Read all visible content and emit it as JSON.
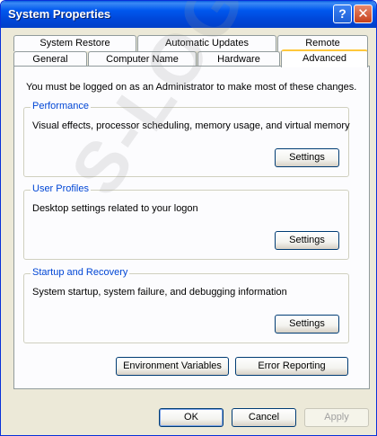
{
  "window": {
    "title": "System Properties",
    "help_glyph": "?",
    "close_glyph": "✕"
  },
  "tabs": {
    "back_row": [
      "System Restore",
      "Automatic Updates",
      "Remote"
    ],
    "front_row": [
      "General",
      "Computer Name",
      "Hardware",
      "Advanced"
    ],
    "active": "Advanced"
  },
  "intro_text": "You must be logged on as an Administrator to make most of these changes.",
  "groups": {
    "performance": {
      "label": "Performance",
      "description": "Visual effects, processor scheduling, memory usage, and virtual memory",
      "button": "Settings"
    },
    "user_profiles": {
      "label": "User Profiles",
      "description": "Desktop settings related to your logon",
      "button": "Settings"
    },
    "startup_recovery": {
      "label": "Startup and Recovery",
      "description": "System startup, system failure, and debugging information",
      "button": "Settings"
    }
  },
  "buttons": {
    "environment_variables": "Environment Variables",
    "error_reporting": "Error Reporting",
    "ok": "OK",
    "cancel": "Cancel",
    "apply": "Apply"
  },
  "watermark": "S-LOGIX"
}
